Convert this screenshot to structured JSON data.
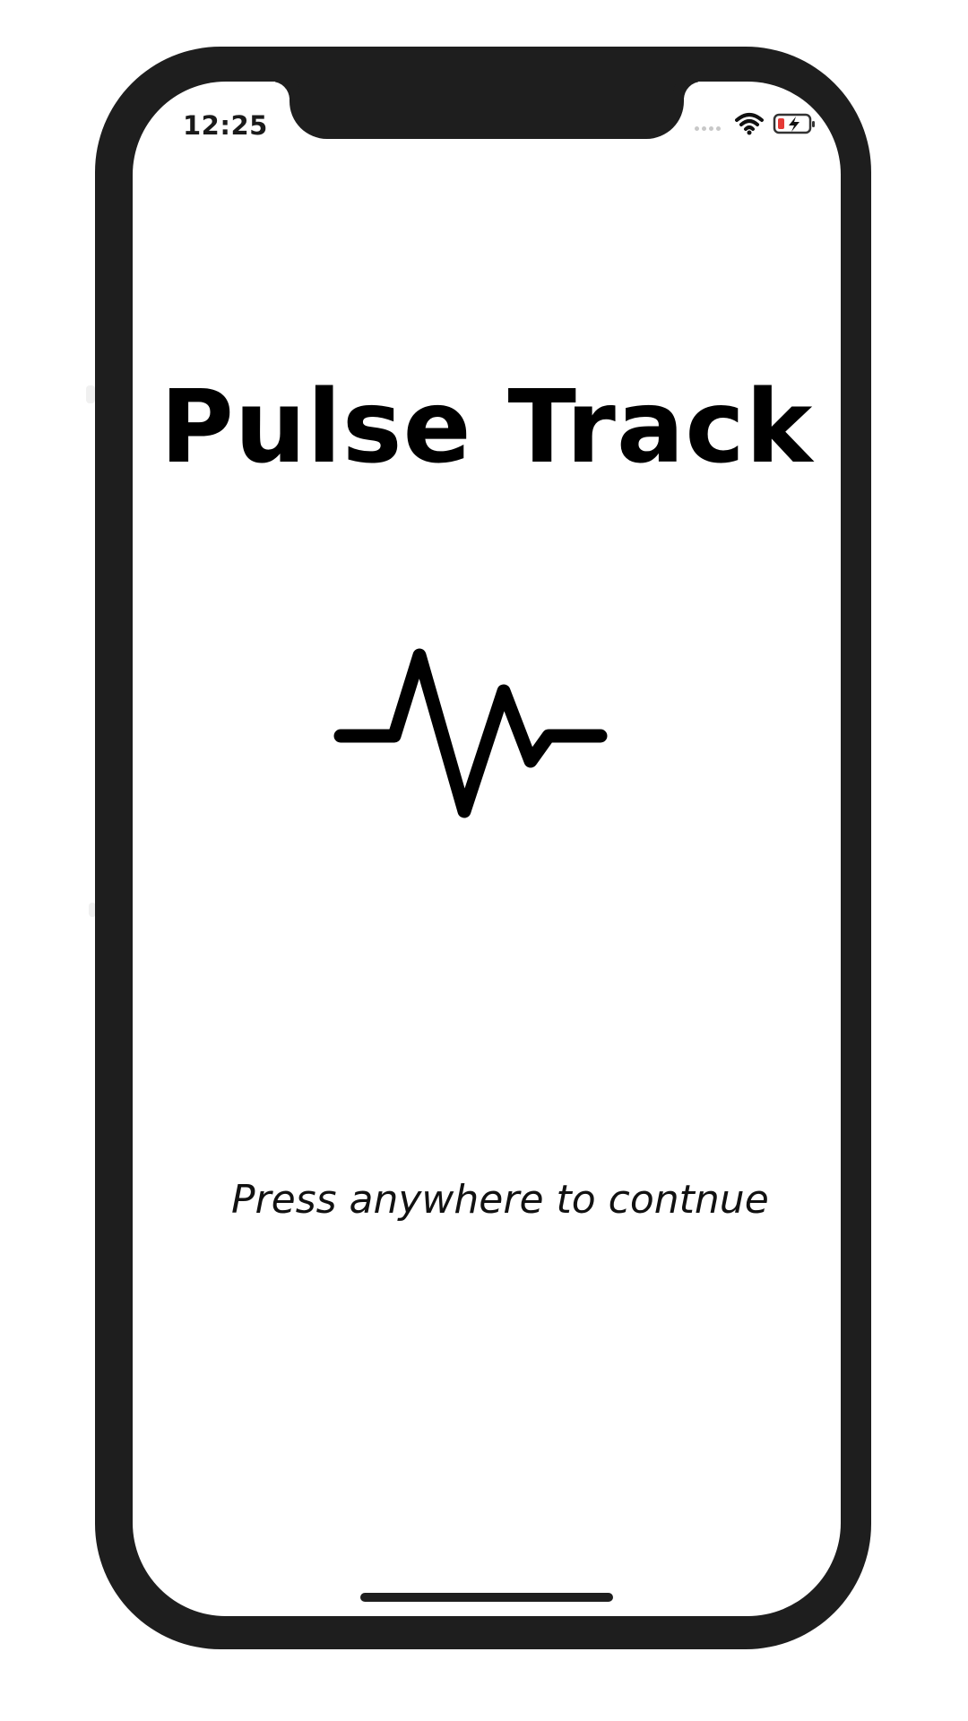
{
  "status_bar": {
    "time": "12:25",
    "icons": [
      "cellular-signal-icon",
      "wifi-icon",
      "battery-charging-icon"
    ],
    "battery_color": "#e53935"
  },
  "splash": {
    "title": "Pulse Track",
    "logo_icon": "heartbeat-pulse-icon",
    "hint": "Press anywhere to contnue"
  },
  "colors": {
    "frame": "#1e1e1e",
    "screen": "#ffffff",
    "text": "#000000"
  }
}
